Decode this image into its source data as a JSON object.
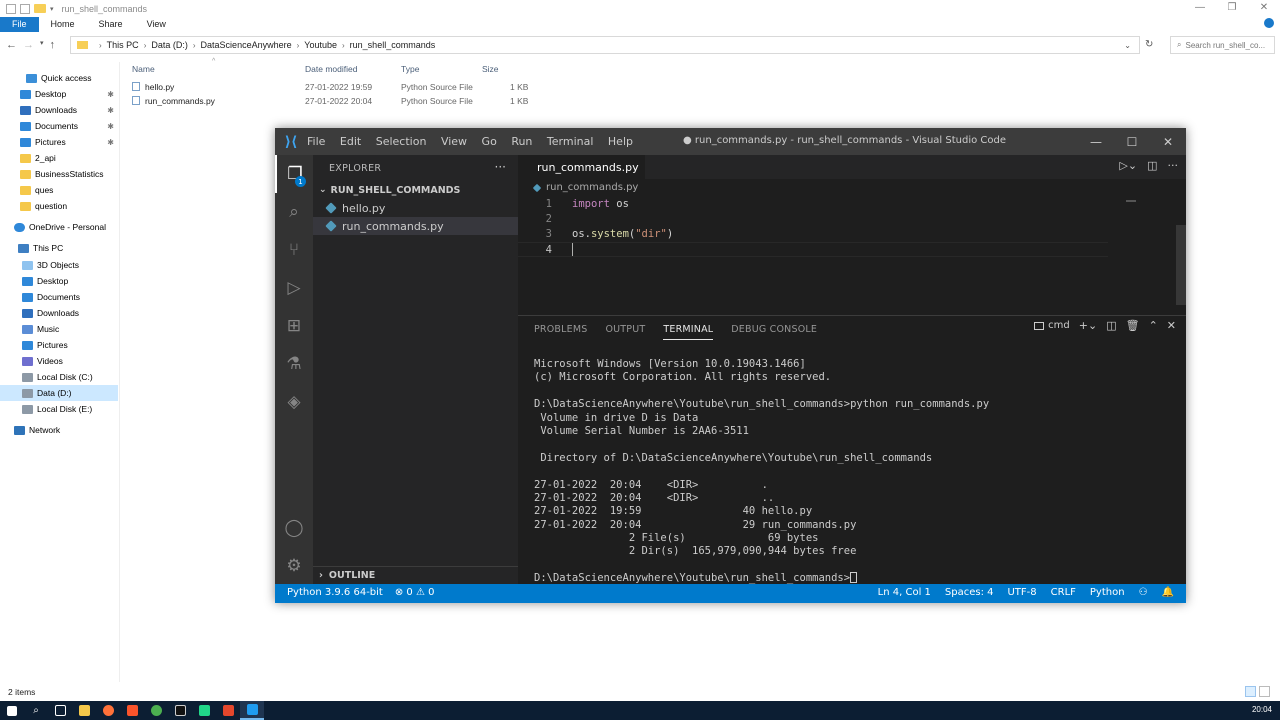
{
  "explorer": {
    "title": "run_shell_commands",
    "ribbon_tabs": [
      "File",
      "Home",
      "Share",
      "View"
    ],
    "breadcrumb": [
      "This PC",
      "Data (D:)",
      "DataScienceAnywhere",
      "Youtube",
      "run_shell_commands"
    ],
    "search_placeholder": "Search run_shell_co...",
    "columns": {
      "name": "Name",
      "date": "Date modified",
      "type": "Type",
      "size": "Size"
    },
    "files": [
      {
        "name": "hello.py",
        "date": "27-01-2022 19:59",
        "type": "Python Source File",
        "size": "1 KB"
      },
      {
        "name": "run_commands.py",
        "date": "27-01-2022 20:04",
        "type": "Python Source File",
        "size": "1 KB"
      }
    ],
    "nav": [
      {
        "label": "Quick access",
        "icon": "star-icon",
        "pinned": false,
        "selected": false
      },
      {
        "label": "Desktop",
        "icon": "desktop-icon",
        "pinned": true,
        "selected": false
      },
      {
        "label": "Downloads",
        "icon": "download-icon",
        "pinned": true,
        "selected": false
      },
      {
        "label": "Documents",
        "icon": "documents-icon",
        "pinned": true,
        "selected": false
      },
      {
        "label": "Pictures",
        "icon": "pictures-icon",
        "pinned": true,
        "selected": false
      },
      {
        "label": "2_api",
        "icon": "folder-icon",
        "pinned": false,
        "selected": false
      },
      {
        "label": "BusinessStatistics",
        "icon": "folder-icon",
        "pinned": false,
        "selected": false
      },
      {
        "label": "ques",
        "icon": "folder-icon",
        "pinned": false,
        "selected": false
      },
      {
        "label": "question",
        "icon": "folder-icon",
        "pinned": false,
        "selected": false
      },
      {
        "label": "OneDrive - Personal",
        "icon": "onedrive-icon",
        "pinned": false,
        "selected": false
      },
      {
        "label": "This PC",
        "icon": "pc-icon",
        "pinned": false,
        "selected": false
      },
      {
        "label": "3D Objects",
        "icon": "3d-objects-icon",
        "pinned": false,
        "selected": false
      },
      {
        "label": "Desktop",
        "icon": "desktop-icon",
        "pinned": false,
        "selected": false
      },
      {
        "label": "Documents",
        "icon": "documents-icon",
        "pinned": false,
        "selected": false
      },
      {
        "label": "Downloads",
        "icon": "download-icon",
        "pinned": false,
        "selected": false
      },
      {
        "label": "Music",
        "icon": "music-icon",
        "pinned": false,
        "selected": false
      },
      {
        "label": "Pictures",
        "icon": "pictures-icon",
        "pinned": false,
        "selected": false
      },
      {
        "label": "Videos",
        "icon": "videos-icon",
        "pinned": false,
        "selected": false
      },
      {
        "label": "Local Disk (C:)",
        "icon": "disk-icon",
        "pinned": false,
        "selected": false
      },
      {
        "label": "Data (D:)",
        "icon": "disk-icon",
        "pinned": false,
        "selected": true
      },
      {
        "label": "Local Disk (E:)",
        "icon": "disk-icon",
        "pinned": false,
        "selected": false
      },
      {
        "label": "Network",
        "icon": "network-icon",
        "pinned": false,
        "selected": false
      }
    ],
    "status_items": "2 items"
  },
  "vscode": {
    "menu": [
      "File",
      "Edit",
      "Selection",
      "View",
      "Go",
      "Run",
      "Terminal",
      "Help"
    ],
    "window_title": "● run_commands.py - run_shell_commands - Visual Studio Code",
    "activity_badge": "1",
    "sidebar": {
      "header": "EXPLORER",
      "section": "RUN_SHELL_COMMANDS",
      "files": [
        "hello.py",
        "run_commands.py"
      ],
      "outline": "OUTLINE"
    },
    "tab_label": "run_commands.py",
    "breadcrumb": "run_commands.py",
    "code_lines": [
      {
        "num": "1",
        "kw": "import",
        "rest": " os",
        "fn": "",
        "str": "",
        "tail": ""
      },
      {
        "num": "2",
        "kw": "",
        "rest": "",
        "fn": "",
        "str": "",
        "tail": ""
      },
      {
        "num": "3",
        "kw": "",
        "rest": "os.",
        "fn": "system",
        "str": "\"dir\"",
        "tail": ")"
      },
      {
        "num": "4",
        "kw": "",
        "rest": "",
        "fn": "",
        "str": "",
        "tail": ""
      }
    ],
    "panel_tabs": [
      "PROBLEMS",
      "OUTPUT",
      "TERMINAL",
      "DEBUG CONSOLE"
    ],
    "shell": "cmd",
    "terminal_lines": [
      "Microsoft Windows [Version 10.0.19043.1466]",
      "(c) Microsoft Corporation. All rights reserved.",
      "",
      "D:\\DataScienceAnywhere\\Youtube\\run_shell_commands>python run_commands.py",
      " Volume in drive D is Data",
      " Volume Serial Number is 2AA6-3511",
      "",
      " Directory of D:\\DataScienceAnywhere\\Youtube\\run_shell_commands",
      "",
      "27-01-2022  20:04    <DIR>          .",
      "27-01-2022  20:04    <DIR>          ..",
      "27-01-2022  19:59                40 hello.py",
      "27-01-2022  20:04                29 run_commands.py",
      "               2 File(s)             69 bytes",
      "               2 Dir(s)  165,979,090,944 bytes free",
      "",
      "D:\\DataScienceAnywhere\\Youtube\\run_shell_commands>"
    ],
    "status_left": [
      "Python 3.9.6 64-bit",
      "⊗ 0 ⚠ 0"
    ],
    "status_right": [
      "Ln 4, Col 1",
      "Spaces: 4",
      "UTF-8",
      "CRLF",
      "Python"
    ]
  },
  "taskbar": {
    "time": "20:04"
  }
}
